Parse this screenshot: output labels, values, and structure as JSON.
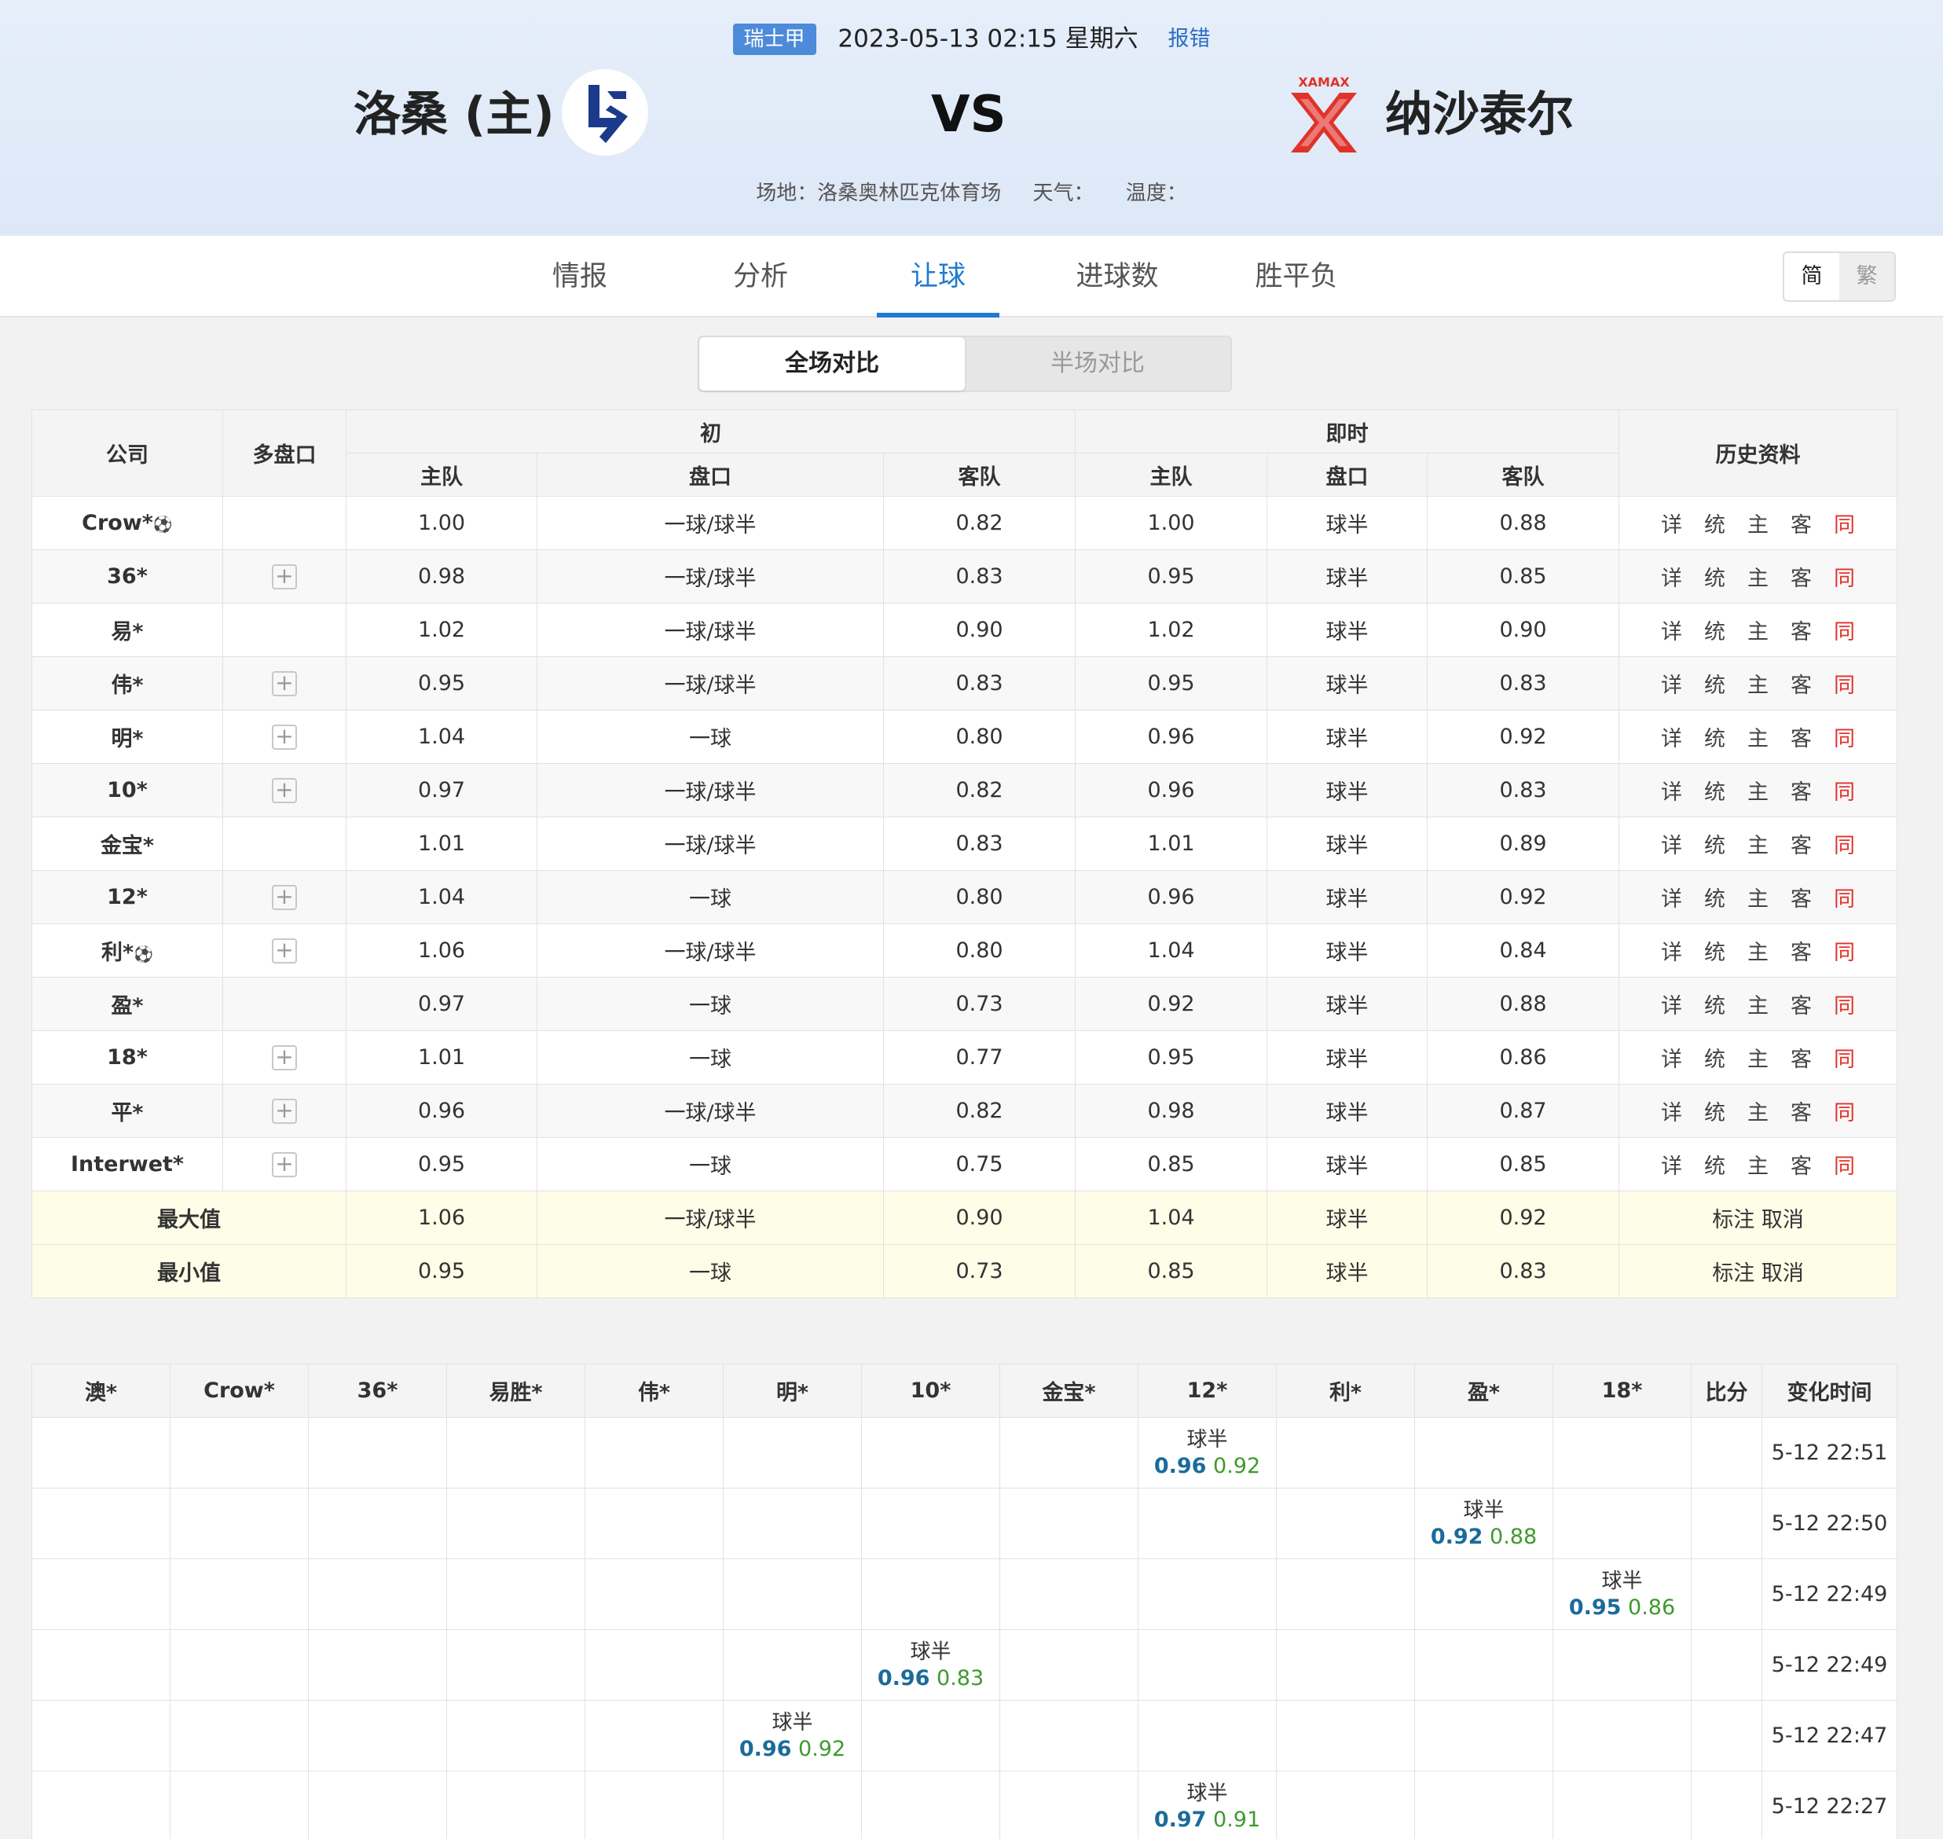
{
  "header": {
    "league": "瑞士甲",
    "datetime": "2023-05-13 02:15 星期六",
    "report": "报错",
    "home_name": "洛桑 (主)",
    "away_name": "纳沙泰尔",
    "vs": "VS",
    "venue": "场地：洛桑奥林匹克体育场",
    "weather": "天气：",
    "temperature": "温度："
  },
  "nav": {
    "tabs": [
      "情报",
      "分析",
      "让球",
      "进球数",
      "胜平负"
    ],
    "active": "让球",
    "lang_simplified": "简",
    "lang_traditional": "繁"
  },
  "segment": {
    "full": "全场对比",
    "half": "半场对比"
  },
  "main_table": {
    "headers": {
      "company": "公司",
      "multi": "多盘口",
      "initial": "初",
      "live": "即时",
      "history": "历史资料",
      "home": "主队",
      "line": "盘口",
      "away": "客队"
    },
    "history_links": [
      "详",
      "统",
      "主",
      "客",
      "同"
    ],
    "rows": [
      {
        "company": "Crow*",
        "ball": "⚽",
        "multi": false,
        "i_home": "1.00",
        "i_line": "一球/球半",
        "i_away": "0.82",
        "l_home": "1.00",
        "l_line": "球半",
        "l_away": "0.88"
      },
      {
        "company": "36*",
        "ball": "",
        "multi": true,
        "i_home": "0.98",
        "i_line": "一球/球半",
        "i_away": "0.83",
        "l_home": "0.95",
        "l_line": "球半",
        "l_away": "0.85"
      },
      {
        "company": "易*",
        "ball": "",
        "multi": false,
        "i_home": "1.02",
        "i_line": "一球/球半",
        "i_away": "0.90",
        "l_home": "1.02",
        "l_line": "球半",
        "l_away": "0.90"
      },
      {
        "company": "伟*",
        "ball": "",
        "multi": true,
        "i_home": "0.95",
        "i_line": "一球/球半",
        "i_away": "0.83",
        "l_home": "0.95",
        "l_line": "球半",
        "l_away": "0.83"
      },
      {
        "company": "明*",
        "ball": "",
        "multi": true,
        "i_home": "1.04",
        "i_line": "一球",
        "i_away": "0.80",
        "l_home": "0.96",
        "l_line": "球半",
        "l_away": "0.92"
      },
      {
        "company": "10*",
        "ball": "",
        "multi": true,
        "i_home": "0.97",
        "i_line": "一球/球半",
        "i_away": "0.82",
        "l_home": "0.96",
        "l_line": "球半",
        "l_away": "0.83"
      },
      {
        "company": "金宝*",
        "ball": "",
        "multi": false,
        "i_home": "1.01",
        "i_line": "一球/球半",
        "i_away": "0.83",
        "l_home": "1.01",
        "l_line": "球半",
        "l_away": "0.89"
      },
      {
        "company": "12*",
        "ball": "",
        "multi": true,
        "i_home": "1.04",
        "i_line": "一球",
        "i_away": "0.80",
        "l_home": "0.96",
        "l_line": "球半",
        "l_away": "0.92"
      },
      {
        "company": "利*",
        "ball": "⚽",
        "multi": true,
        "i_home": "1.06",
        "i_line": "一球/球半",
        "i_away": "0.80",
        "l_home": "1.04",
        "l_line": "球半",
        "l_away": "0.84"
      },
      {
        "company": "盈*",
        "ball": "",
        "multi": false,
        "i_home": "0.97",
        "i_line": "一球",
        "i_away": "0.73",
        "l_home": "0.92",
        "l_line": "球半",
        "l_away": "0.88"
      },
      {
        "company": "18*",
        "ball": "",
        "multi": true,
        "i_home": "1.01",
        "i_line": "一球",
        "i_away": "0.77",
        "l_home": "0.95",
        "l_line": "球半",
        "l_away": "0.86"
      },
      {
        "company": "平*",
        "ball": "",
        "multi": true,
        "i_home": "0.96",
        "i_line": "一球/球半",
        "i_away": "0.82",
        "l_home": "0.98",
        "l_line": "球半",
        "l_away": "0.87"
      },
      {
        "company": "Interwet*",
        "ball": "",
        "multi": true,
        "i_home": "0.95",
        "i_line": "一球",
        "i_away": "0.75",
        "l_home": "0.85",
        "l_line": "球半",
        "l_away": "0.85"
      }
    ],
    "summary": [
      {
        "label": "最大值",
        "i_home": "1.06",
        "i_line": "一球/球半",
        "i_away": "0.90",
        "l_home": "1.04",
        "l_line": "球半",
        "l_away": "0.92",
        "action": "标注 取消"
      },
      {
        "label": "最小值",
        "i_home": "0.95",
        "i_line": "一球",
        "i_away": "0.73",
        "l_home": "0.85",
        "l_line": "球半",
        "l_away": "0.83",
        "action": "标注 取消"
      }
    ]
  },
  "change_table": {
    "headers": [
      "澳*",
      "Crow*",
      "36*",
      "易胜*",
      "伟*",
      "明*",
      "10*",
      "金宝*",
      "12*",
      "利*",
      "盈*",
      "18*",
      "比分",
      "变化时间"
    ],
    "rows": [
      {
        "col": 8,
        "line": "球半",
        "home": "0.96",
        "away": "0.92",
        "time": "5-12 22:51"
      },
      {
        "col": 10,
        "line": "球半",
        "home": "0.92",
        "away": "0.88",
        "time": "5-12 22:50"
      },
      {
        "col": 11,
        "line": "球半",
        "home": "0.95",
        "away": "0.86",
        "time": "5-12 22:49"
      },
      {
        "col": 6,
        "line": "球半",
        "home": "0.96",
        "away": "0.83",
        "time": "5-12 22:49"
      },
      {
        "col": 5,
        "line": "球半",
        "home": "0.96",
        "away": "0.92",
        "time": "5-12 22:47"
      },
      {
        "col": 8,
        "line": "球半",
        "home": "0.97",
        "away": "0.91",
        "time": "5-12 22:27"
      }
    ]
  },
  "colors": {
    "accent": "#1f7ad1",
    "league_badge": "#4d8ad9",
    "home_logo": "#1b3a8c",
    "away_logo": "#e0322b",
    "same_link": "#e0322b",
    "summary_bg": "#fdfde8"
  }
}
